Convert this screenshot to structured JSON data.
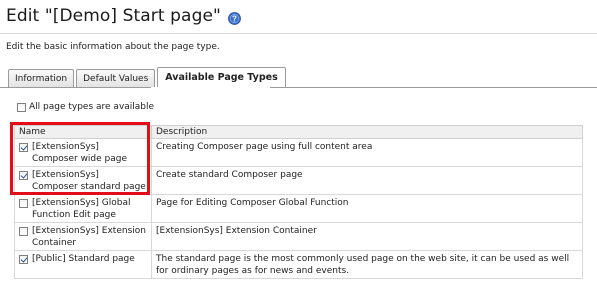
{
  "header": {
    "title": "Edit \"[Demo] Start page\"",
    "help_icon": "help-icon"
  },
  "intro_text": "Edit the basic information about the page type.",
  "tabs": [
    {
      "label": "Information",
      "active": false
    },
    {
      "label": "Default Values",
      "active": false
    },
    {
      "label": "Available Page Types",
      "active": true
    }
  ],
  "all_types": {
    "label": "All page types are available",
    "checked": false
  },
  "table": {
    "columns": [
      "Name",
      "Description"
    ],
    "rows": [
      {
        "name": "[ExtensionSys] Composer wide page",
        "description": "Creating Composer page using full content area",
        "checked": true
      },
      {
        "name": "[ExtensionSys] Composer standard page",
        "description": "Create standard Composer page",
        "checked": true
      },
      {
        "name": "[ExtensionSys] Global Function Edit page",
        "description": "Page for Editing Composer Global Function",
        "checked": false
      },
      {
        "name": "[ExtensionSys] Extension Container",
        "description": "[ExtensionSys] Extension Container",
        "checked": false
      },
      {
        "name": "[Public] Standard page",
        "description": "The standard page is the most commonly used page on the web site, it can be used as well for ordinary pages as for news and events.",
        "checked": true
      }
    ]
  },
  "colors": {
    "highlight": "#e30c19",
    "help_icon": "#3a6fc7"
  }
}
